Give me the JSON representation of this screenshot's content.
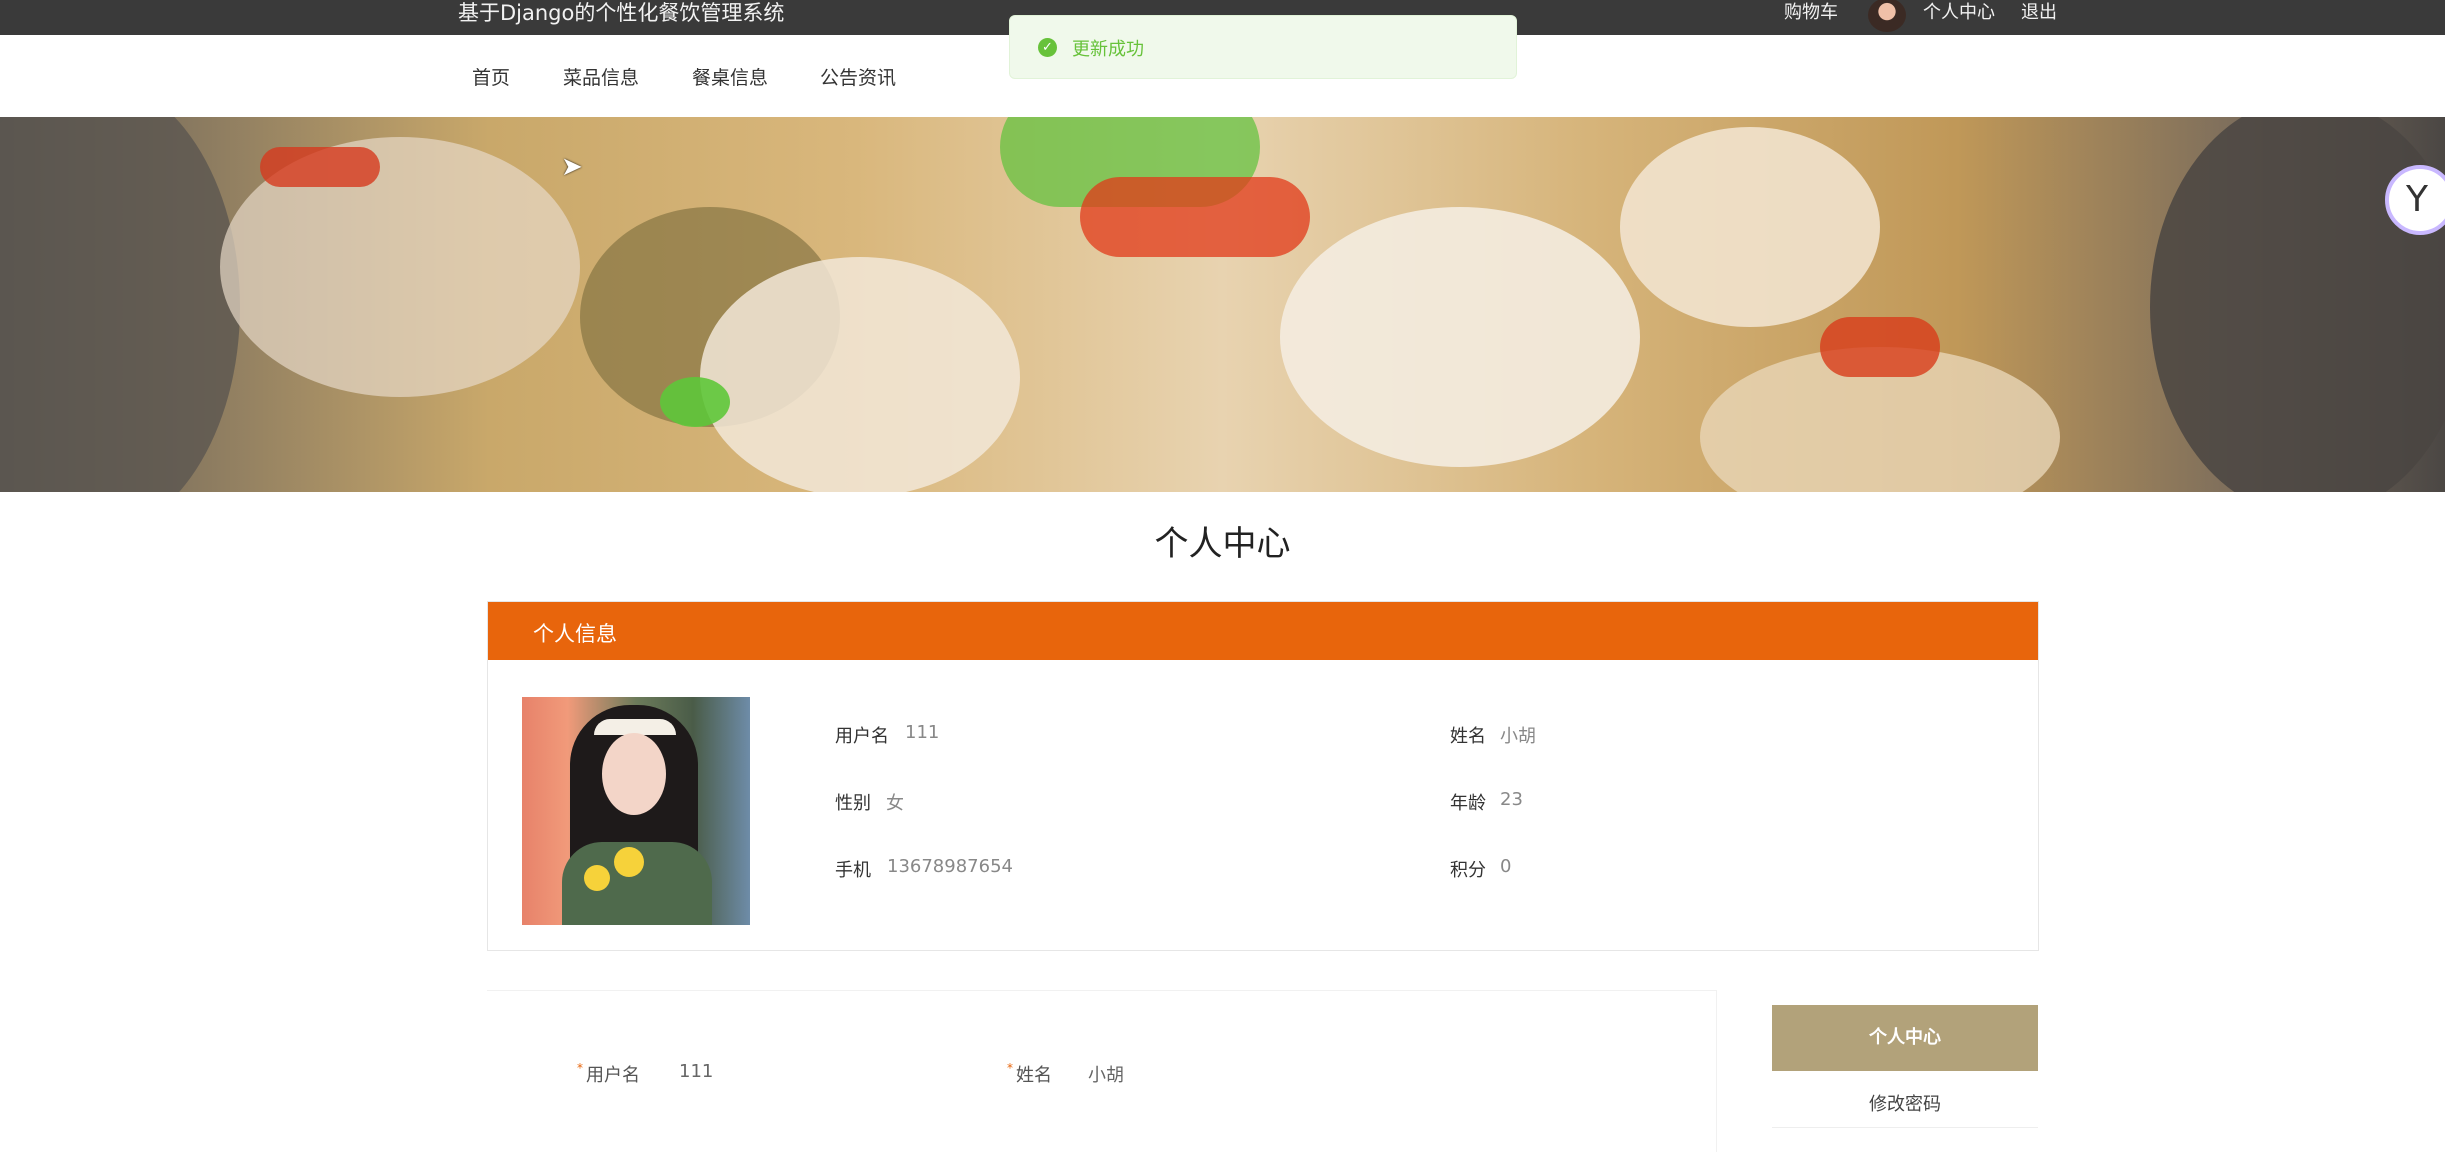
{
  "header": {
    "site_title": "基于Django的个性化餐饮管理系统",
    "cart": "购物车",
    "profile": "个人中心",
    "logout": "退出"
  },
  "toast": {
    "message": "更新成功",
    "icon": "check-circle-icon",
    "color": "#67c23a"
  },
  "nav": {
    "items": [
      "首页",
      "菜品信息",
      "餐桌信息",
      "公告资讯"
    ]
  },
  "banner": {
    "slides": 2,
    "active_slide": 1
  },
  "page": {
    "title": "个人中心"
  },
  "info_card": {
    "title": "个人信息",
    "accent": "#e8650c",
    "fields": [
      {
        "label": "用户名",
        "value": "111"
      },
      {
        "label": "姓名",
        "value": "小胡"
      },
      {
        "label": "性别",
        "value": "女"
      },
      {
        "label": "年龄",
        "value": "23"
      },
      {
        "label": "手机",
        "value": "13678987654"
      },
      {
        "label": "积分",
        "value": "0"
      }
    ]
  },
  "form": {
    "username_label": "用户名",
    "username_value": "111",
    "name_label": "姓名",
    "name_value": "小胡",
    "required_mark": "*"
  },
  "side_menu": {
    "active": "个人中心",
    "items": [
      "修改密码"
    ],
    "active_color": "#b2a27a"
  }
}
